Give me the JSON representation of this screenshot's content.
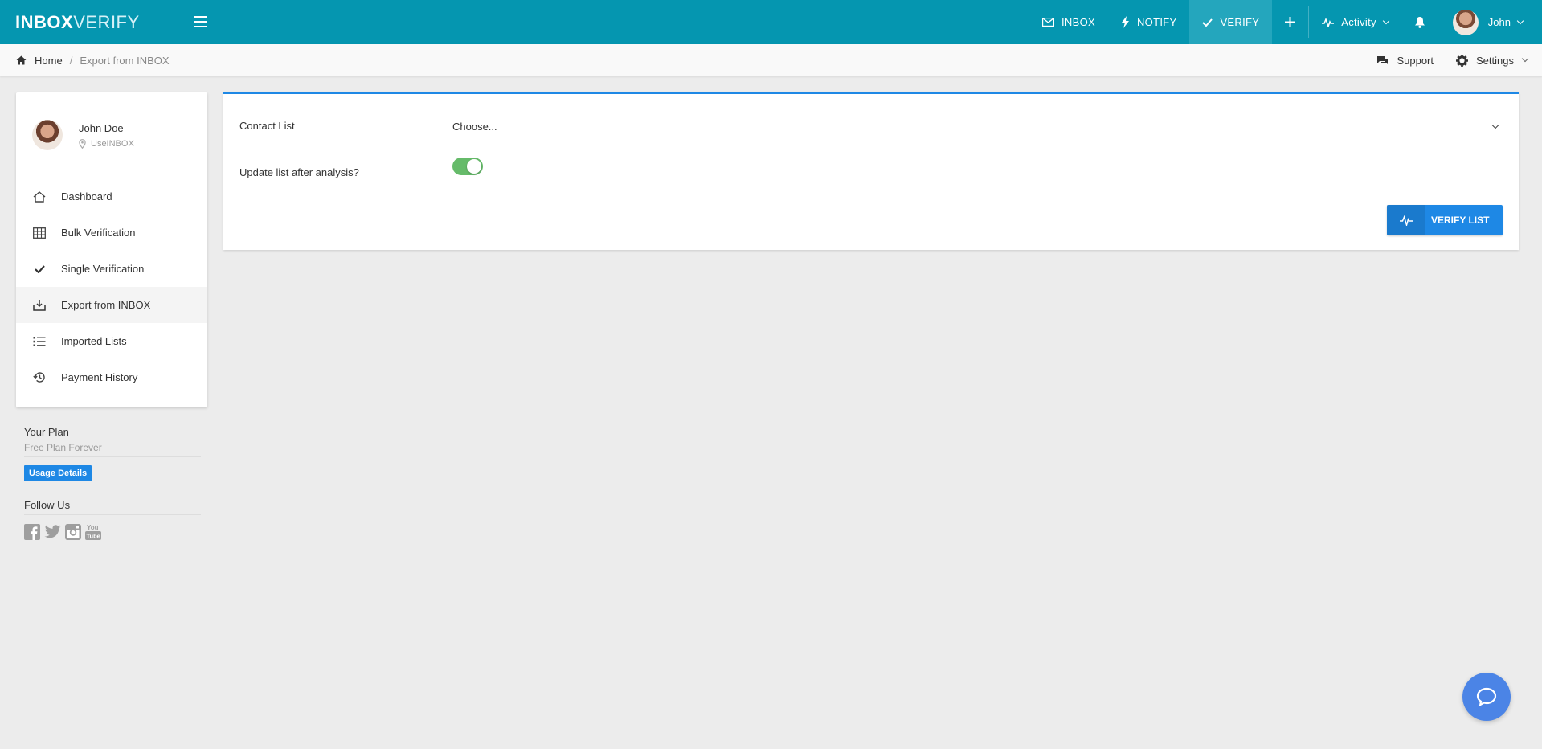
{
  "brand": {
    "logo_strong": "INB",
    "logo_o": "O",
    "logo_x": "X",
    "logo_light": "VERIFY",
    "topbar_color": "#0596b0",
    "accent_color": "#1e88e5"
  },
  "topnav": {
    "items": [
      {
        "label": "INBOX",
        "icon": "envelope-icon"
      },
      {
        "label": "NOTIFY",
        "icon": "lightning-icon"
      },
      {
        "label": "VERIFY",
        "icon": "check-icon",
        "active": true
      }
    ],
    "activity_label": "Activity",
    "user_label": "John"
  },
  "breadcrumb": {
    "home": "Home",
    "separator": "/",
    "current": "Export from INBOX"
  },
  "header_right": {
    "support": "Support",
    "settings": "Settings"
  },
  "profile": {
    "name": "John Doe",
    "location": "UseINBOX"
  },
  "sidebar": {
    "items": [
      {
        "label": "Dashboard",
        "icon": "home-icon"
      },
      {
        "label": "Bulk Verification",
        "icon": "table-icon"
      },
      {
        "label": "Single Verification",
        "icon": "check-icon"
      },
      {
        "label": "Export from INBOX",
        "icon": "tray-download-icon",
        "active": true
      },
      {
        "label": "Imported Lists",
        "icon": "list-icon"
      },
      {
        "label": "Payment History",
        "icon": "history-icon"
      }
    ]
  },
  "plan": {
    "title": "Your Plan",
    "name": "Free Plan Forever",
    "usage_button": "Usage Details"
  },
  "follow": {
    "title": "Follow Us",
    "youtube_top": "You",
    "youtube_bottom": "Tube"
  },
  "form": {
    "contact_list_label": "Contact List",
    "contact_list_value": "Choose...",
    "update_label": "Update list after analysis?",
    "update_enabled": true,
    "submit_label": "VERIFY LIST"
  }
}
